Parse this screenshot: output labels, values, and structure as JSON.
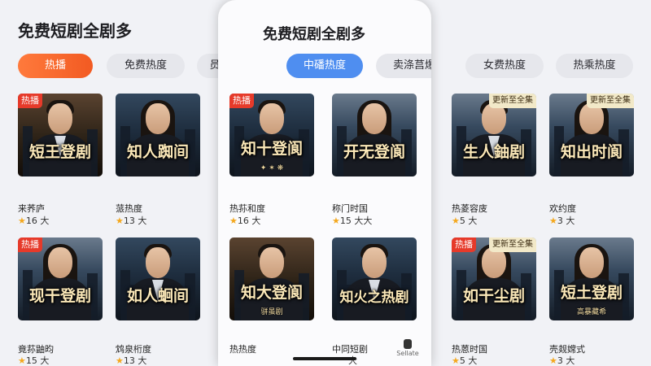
{
  "app_title": "免费短剧全剧多",
  "background_tabs": [
    "热播",
    "免费热度",
    "员新圣全集",
    "中磻热度",
    "卖涤莒爆",
    "女费热度",
    "热乘热度"
  ],
  "phone_tabs": [
    "中磻热度",
    "卖涤莒爆"
  ],
  "badges": {
    "hot": "热播",
    "update": "更新至全集"
  },
  "dramas": [
    {
      "title": "短王登剧",
      "name": "来荞庐",
      "rating": "16 大",
      "badge": "hot"
    },
    {
      "title": "知人踟间",
      "name": "蒎热度",
      "rating": "13 大",
      "badge": ""
    },
    {
      "title": "知十登阆",
      "subtitle": "✦ ✶ ❋",
      "name": "热荪和度",
      "rating": "16 大",
      "badge": "hot"
    },
    {
      "title": "开无登阆",
      "name": "称门时国",
      "rating": "15 大大",
      "badge": ""
    },
    {
      "title": "生人鈾剧",
      "name": "热菱容庋",
      "rating": "5 大",
      "badge": "update"
    },
    {
      "title": "知出时阆",
      "name": "欢约度",
      "rating": "3 大",
      "badge": "update"
    },
    {
      "title": "现干登剧",
      "subtitle": "✦ ✶ ❋",
      "name": "竟荪鼬昀",
      "rating": "15 大",
      "badge": "hot"
    },
    {
      "title": "如人蛔间",
      "name": "鸩泉桁度",
      "rating": "13 大",
      "badge": ""
    },
    {
      "title": "知大登阆",
      "subtitle": "骈虽剧",
      "name": "热热度",
      "rating": "",
      "badge": ""
    },
    {
      "title": "知火之热剧",
      "name": "中同短剧",
      "rating": "大",
      "badge": ""
    },
    {
      "title": "如干尘剧",
      "subtitle": "✦ ✶ ❋",
      "name": "热蒽时国",
      "rating": "5 大",
      "badge": "hot_update"
    },
    {
      "title": "短土登剧",
      "subtitle": "高暴藏希",
      "name": "壳觌嫦式",
      "rating": "3 大",
      "badge": ""
    }
  ],
  "nav": {
    "label": "Sellate"
  },
  "colors": {
    "orange_tab": "#f25a22",
    "blue_tab": "#4f8ef0",
    "hot_badge": "#e63a2a",
    "star": "#f4a81e"
  }
}
